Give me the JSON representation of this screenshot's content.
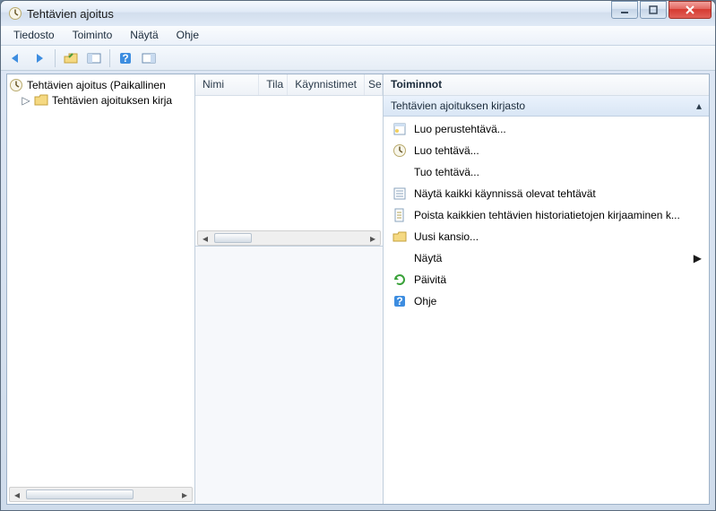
{
  "titlebar": {
    "title": "Tehtävien ajoitus"
  },
  "menu": {
    "file": "Tiedosto",
    "action": "Toiminto",
    "view": "Näytä",
    "help": "Ohje"
  },
  "tree": {
    "root": "Tehtävien ajoitus (Paikallinen",
    "library": "Tehtävien ajoituksen kirja"
  },
  "columns": {
    "name": "Nimi",
    "state": "Tila",
    "triggers": "Käynnistimet",
    "next": "Se"
  },
  "actions": {
    "header": "Toiminnot",
    "section": "Tehtävien ajoituksen kirjasto",
    "items": [
      {
        "icon": "wizard",
        "label": "Luo perustehtävä..."
      },
      {
        "icon": "clock",
        "label": "Luo tehtävä..."
      },
      {
        "icon": "blank",
        "label": "Tuo tehtävä..."
      },
      {
        "icon": "list",
        "label": "Näytä kaikki käynnissä olevat tehtävät"
      },
      {
        "icon": "doc",
        "label": "Poista kaikkien tehtävien historiatietojen kirjaaminen k..."
      },
      {
        "icon": "folder",
        "label": "Uusi kansio..."
      },
      {
        "icon": "blank",
        "label": "Näytä",
        "submenu": true
      },
      {
        "icon": "refresh",
        "label": "Päivitä"
      },
      {
        "icon": "help",
        "label": "Ohje"
      }
    ]
  }
}
